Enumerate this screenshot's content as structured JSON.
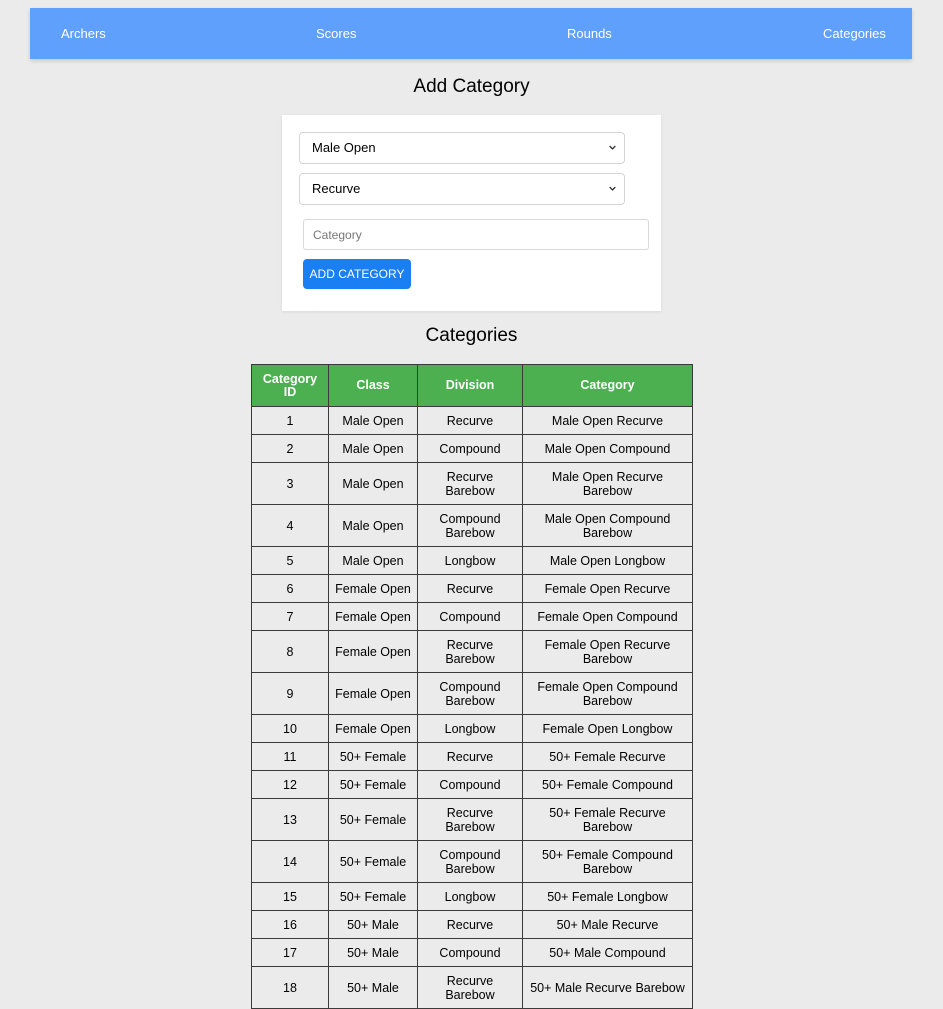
{
  "nav": {
    "archers": "Archers",
    "scores": "Scores",
    "rounds": "Rounds",
    "categories": "Categories"
  },
  "add_category": {
    "title": "Add Category",
    "class_select_value": "Male Open",
    "division_select_value": "Recurve",
    "category_placeholder": "Category",
    "button_label": "ADD CATEGORY"
  },
  "categories_section": {
    "title": "Categories",
    "columns": [
      "Category ID",
      "Class",
      "Division",
      "Category"
    ],
    "rows": [
      [
        "1",
        "Male Open",
        "Recurve",
        "Male Open Recurve"
      ],
      [
        "2",
        "Male Open",
        "Compound",
        "Male Open Compound"
      ],
      [
        "3",
        "Male Open",
        "Recurve Barebow",
        "Male Open Recurve Barebow"
      ],
      [
        "4",
        "Male Open",
        "Compound Barebow",
        "Male Open Compound Barebow"
      ],
      [
        "5",
        "Male Open",
        "Longbow",
        "Male Open Longbow"
      ],
      [
        "6",
        "Female Open",
        "Recurve",
        "Female Open Recurve"
      ],
      [
        "7",
        "Female Open",
        "Compound",
        "Female Open Compound"
      ],
      [
        "8",
        "Female Open",
        "Recurve Barebow",
        "Female Open Recurve Barebow"
      ],
      [
        "9",
        "Female Open",
        "Compound Barebow",
        "Female Open Compound Barebow"
      ],
      [
        "10",
        "Female Open",
        "Longbow",
        "Female Open Longbow"
      ],
      [
        "11",
        "50+ Female",
        "Recurve",
        "50+ Female Recurve"
      ],
      [
        "12",
        "50+ Female",
        "Compound",
        "50+ Female Compound"
      ],
      [
        "13",
        "50+ Female",
        "Recurve Barebow",
        "50+ Female Recurve Barebow"
      ],
      [
        "14",
        "50+ Female",
        "Compound Barebow",
        "50+ Female Compound Barebow"
      ],
      [
        "15",
        "50+ Female",
        "Longbow",
        "50+ Female Longbow"
      ],
      [
        "16",
        "50+ Male",
        "Recurve",
        "50+ Male Recurve"
      ],
      [
        "17",
        "50+ Male",
        "Compound",
        "50+ Male Compound"
      ],
      [
        "18",
        "50+ Male",
        "Recurve Barebow",
        "50+ Male Recurve Barebow"
      ]
    ]
  },
  "colors": {
    "navbar": "#5ea0fb",
    "table_header": "#4caf50",
    "button": "#1a7ff2",
    "page_background": "#ebebeb"
  }
}
